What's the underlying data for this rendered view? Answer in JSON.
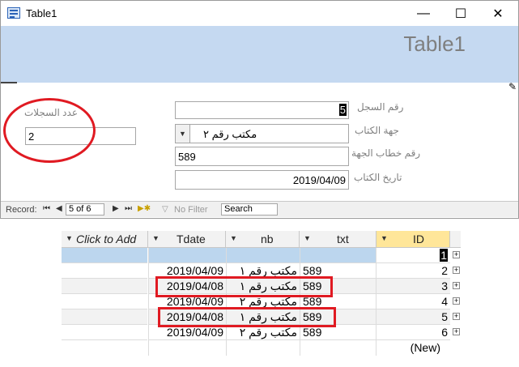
{
  "window": {
    "title": "Table1",
    "heading": "Table1",
    "controls": [
      "minimize",
      "maximize",
      "close"
    ]
  },
  "form": {
    "count_label": "عدد السجلات",
    "count_value": "2",
    "record_label": "رقم السجل",
    "record_value": "5",
    "party_label": "جهة الكتاب",
    "party_value": "مكتب رقم ٢",
    "letter_label": "رقم خطاب الجهة",
    "letter_value": "589",
    "date_label": "تاريخ الكتاب",
    "date_value": "2019/04/09"
  },
  "navigation": {
    "record_label": "Record:",
    "position": "5 of 6",
    "filter_label": "No Filter",
    "search_placeholder": "Search"
  },
  "datasheet": {
    "headers": {
      "add": "Click to Add",
      "date": "Tdate",
      "nb": "nb",
      "txt": "txt",
      "id": "ID"
    },
    "rows": [
      {
        "date": "",
        "nb": "",
        "txt": "",
        "id": "1"
      },
      {
        "date": "2019/04/09",
        "nb": "مكتب رقم ١",
        "txt": "589",
        "id": "2"
      },
      {
        "date": "2019/04/08",
        "nb": "مكتب رقم ١",
        "txt": "589",
        "id": "3"
      },
      {
        "date": "2019/04/09",
        "nb": "مكتب رقم ٢",
        "txt": "589",
        "id": "4"
      },
      {
        "date": "2019/04/08",
        "nb": "مكتب رقم ١",
        "txt": "589",
        "id": "5"
      },
      {
        "date": "2019/04/09",
        "nb": "مكتب رقم ٢",
        "txt": "589",
        "id": "6"
      }
    ],
    "new_row_label": "(New)"
  },
  "colors": {
    "header_band": "#c5d9f1",
    "annotation_red": "#e01a22",
    "selected_row": "#bcd6ee",
    "id_header": "#ffe699"
  }
}
